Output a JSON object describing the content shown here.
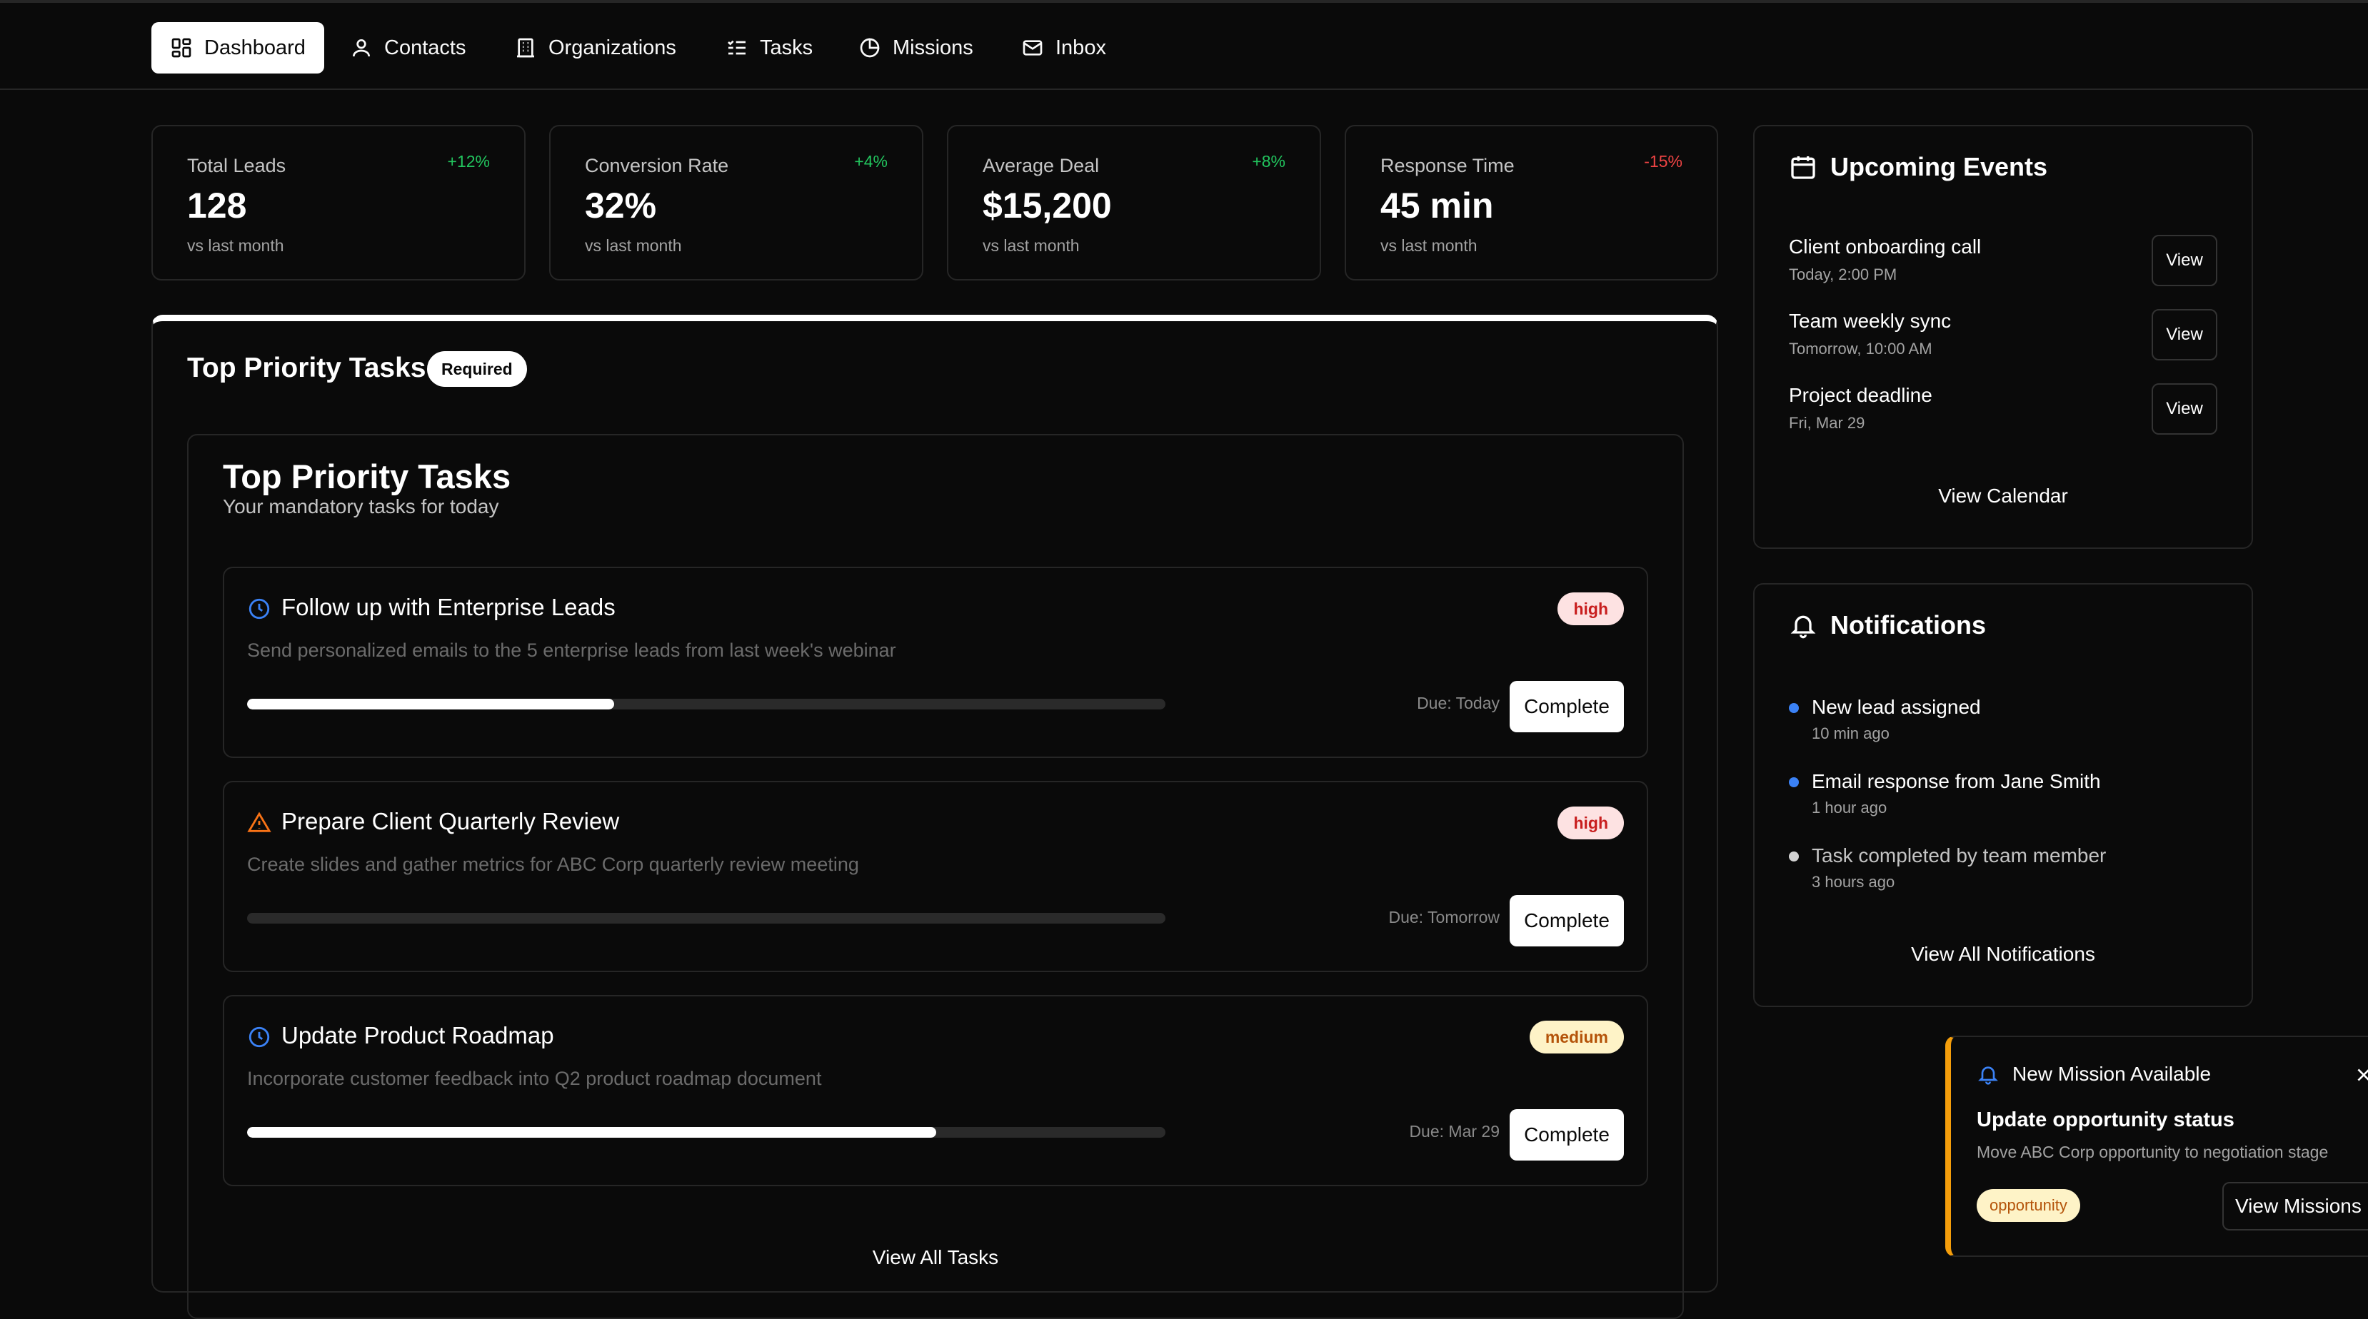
{
  "nav": {
    "items": [
      {
        "label": "Dashboard",
        "icon": "dashboard-icon",
        "active": true
      },
      {
        "label": "Contacts",
        "icon": "user-icon"
      },
      {
        "label": "Organizations",
        "icon": "building-icon"
      },
      {
        "label": "Tasks",
        "icon": "list-check-icon"
      },
      {
        "label": "Missions",
        "icon": "pie-chart-icon"
      },
      {
        "label": "Inbox",
        "icon": "mail-icon"
      }
    ]
  },
  "stats": [
    {
      "label": "Total Leads",
      "value": "128",
      "sub": "vs last month",
      "delta": "+12%",
      "trend": "up"
    },
    {
      "label": "Conversion Rate",
      "value": "32%",
      "sub": "vs last month",
      "delta": "+4%",
      "trend": "up"
    },
    {
      "label": "Average Deal",
      "value": "$15,200",
      "sub": "vs last month",
      "delta": "+8%",
      "trend": "up"
    },
    {
      "label": "Response Time",
      "value": "45 min",
      "sub": "vs last month",
      "delta": "-15%",
      "trend": "down"
    }
  ],
  "colors": {
    "positive": "#22c55e",
    "negative": "#ef4444",
    "accent_warning": "#f59e0b",
    "dot_blue": "#3b82f6",
    "dot_gray": "#d4d4d4"
  },
  "priority": {
    "header_title": "Top Priority Tasks",
    "badge": "Required",
    "inner_title": "Top Priority Tasks",
    "inner_subtitle": "Your mandatory tasks for today",
    "tasks": [
      {
        "icon": "clock-icon",
        "title": "Follow up with Enterprise Leads",
        "description": "Send personalized emails to the 5 enterprise leads from last week's webinar",
        "priority": "high",
        "progress": 0.4,
        "due": "Due: Today",
        "action": "Complete"
      },
      {
        "icon": "warning-icon",
        "title": "Prepare Client Quarterly Review",
        "description": "Create slides and gather metrics for ABC Corp quarterly review meeting",
        "priority": "high",
        "progress": 0.0,
        "due": "Due: Tomorrow",
        "action": "Complete"
      },
      {
        "icon": "clock-icon",
        "title": "Update Product Roadmap",
        "description": "Incorporate customer feedback into Q2 product roadmap document",
        "priority": "medium",
        "progress": 0.75,
        "due": "Due: Mar 29",
        "action": "Complete"
      }
    ],
    "view_all": "View All Tasks"
  },
  "events": {
    "title": "Upcoming Events",
    "items": [
      {
        "title": "Client onboarding call",
        "time": "Today, 2:00 PM",
        "action": "View"
      },
      {
        "title": "Team weekly sync",
        "time": "Tomorrow, 10:00 AM",
        "action": "View"
      },
      {
        "title": "Project deadline",
        "time": "Fri, Mar 29",
        "action": "View"
      }
    ],
    "footer": "View Calendar"
  },
  "notifications": {
    "title": "Notifications",
    "items": [
      {
        "title": "New lead assigned",
        "time": "10 min ago",
        "unread": true
      },
      {
        "title": "Email response from Jane Smith",
        "time": "1 hour ago",
        "unread": true
      },
      {
        "title": "Task completed by team member",
        "time": "3 hours ago",
        "unread": false
      }
    ],
    "footer": "View All Notifications"
  },
  "toast": {
    "heading": "New Mission Available",
    "title": "Update opportunity status",
    "description": "Move ABC Corp opportunity to negotiation stage",
    "tag": "opportunity",
    "action": "View Missions"
  }
}
